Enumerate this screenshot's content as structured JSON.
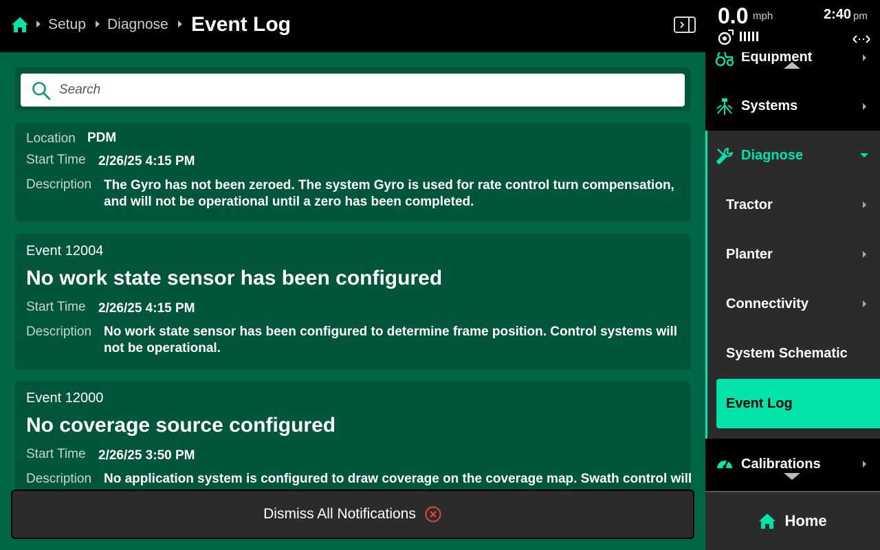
{
  "header": {
    "breadcrumbs": [
      "Setup",
      "Diagnose"
    ],
    "title": "Event Log"
  },
  "status": {
    "speed": "0.0",
    "speed_unit": "mph",
    "time": "2:40",
    "ampm": "pm"
  },
  "search": {
    "placeholder": "Search",
    "value": ""
  },
  "events": [
    {
      "location_label": "Location",
      "location": "PDM",
      "start_label": "Start Time",
      "start_time": "2/26/25 4:15 PM",
      "desc_label": "Description",
      "description_lines": [
        "The Gyro has not been zeroed. The system Gyro is used for rate control turn compensation,",
        "and will not be operational until a zero has been completed."
      ]
    },
    {
      "id": "Event 12004",
      "title": "No work state sensor has been configured",
      "start_label": "Start Time",
      "start_time": "2/26/25 4:15 PM",
      "desc_label": "Description",
      "description_lines": [
        "No work state sensor has been configured to determine frame position. Control systems will",
        "not be operational."
      ]
    },
    {
      "id": "Event 12000",
      "title": "No coverage source configured",
      "start_label": "Start Time",
      "start_time": "2/26/25 3:50 PM",
      "desc_label": "Description",
      "description_lines": [
        "No application system is configured to draw coverage on the coverage map. Swath control will"
      ]
    }
  ],
  "dismiss_label": "Dismiss All Notifications",
  "sidebar": {
    "items": [
      {
        "label": "Equipment",
        "icon": "tractor-icon"
      },
      {
        "label": "Systems",
        "icon": "systems-icon"
      },
      {
        "label": "Diagnose",
        "icon": "wrench-icon"
      },
      {
        "label": "Calibrations",
        "icon": "gauge-icon"
      }
    ],
    "sub_items": [
      {
        "label": "Tractor"
      },
      {
        "label": "Planter"
      },
      {
        "label": "Connectivity"
      },
      {
        "label": "System Schematic"
      },
      {
        "label": "Event Log"
      }
    ]
  },
  "home_label": "Home",
  "colors": {
    "accent": "#00e3a9",
    "content_bg": "#006646",
    "card_bg": "#00553a",
    "dismiss_icon": "#e04a3a"
  }
}
